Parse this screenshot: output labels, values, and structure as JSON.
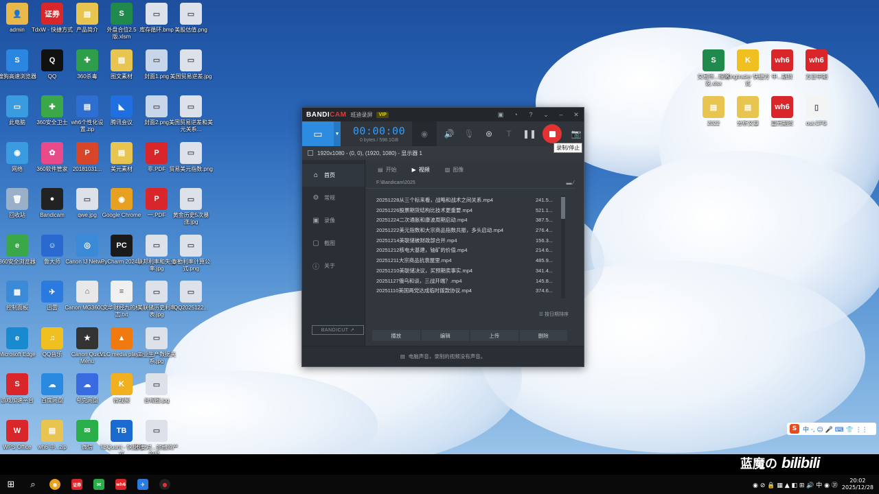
{
  "desktop_icons": [
    {
      "label": "admin",
      "color": "#e8b84a",
      "glyph": "👤"
    },
    {
      "label": "TdxW - 快捷方式",
      "color": "#d8262a",
      "glyph": "证券"
    },
    {
      "label": "产品简介",
      "color": "#e8c450",
      "glyph": "▤"
    },
    {
      "label": "外盘合位2.5版.xlsm",
      "color": "#1f8a4c",
      "glyph": "S"
    },
    {
      "label": "库存循环.bmp",
      "color": "#dde2ea",
      "glyph": "▭"
    },
    {
      "label": "美股估值.png",
      "color": "#dde2ea",
      "glyph": "▭"
    },
    {
      "label": "搜狗高速浏览器",
      "color": "#2a86e0",
      "glyph": "S"
    },
    {
      "label": "QQ",
      "color": "#111111",
      "glyph": "Q"
    },
    {
      "label": "360杀毒",
      "color": "#2e9e4a",
      "glyph": "✚"
    },
    {
      "label": "图文素材",
      "color": "#e8c450",
      "glyph": "▤"
    },
    {
      "label": "封面1.png",
      "color": "#c8d6ea",
      "glyph": "▭"
    },
    {
      "label": "美国贸易逆差.jpg",
      "color": "#dde2ea",
      "glyph": "▭"
    },
    {
      "label": "此电脑",
      "color": "#3a9be0",
      "glyph": "▭"
    },
    {
      "label": "360安全卫士",
      "color": "#3aa848",
      "glyph": "✚"
    },
    {
      "label": "wh6个性化设置.zip",
      "color": "#2e6ed0",
      "glyph": "▤"
    },
    {
      "label": "腾讯会议",
      "color": "#1f6fe0",
      "glyph": "◣"
    },
    {
      "label": "封面2.png",
      "color": "#c8d6ea",
      "glyph": "▭"
    },
    {
      "label": "美国贸易逆差和美元关系...",
      "color": "#dde2ea",
      "glyph": "▭"
    },
    {
      "label": "网络",
      "color": "#3a9be0",
      "glyph": "◉"
    },
    {
      "label": "360软件管家",
      "color": "#e84a8a",
      "glyph": "✿"
    },
    {
      "label": "20181031...",
      "color": "#d8462a",
      "glyph": "P"
    },
    {
      "label": "美元素材",
      "color": "#e8c450",
      "glyph": "▤"
    },
    {
      "label": "非.PDF",
      "color": "#d8262a",
      "glyph": "P"
    },
    {
      "label": "贸易美元指数.png",
      "color": "#dde2ea",
      "glyph": "▭"
    },
    {
      "label": "回收站",
      "color": "#9ab0c8",
      "glyph": "🗑"
    },
    {
      "label": "Bandicam",
      "color": "#222222",
      "glyph": "●"
    },
    {
      "label": "qwe.jpg",
      "color": "#dde2ea",
      "glyph": "▭"
    },
    {
      "label": "Google Chrome",
      "color": "#e8a020",
      "glyph": "◉"
    },
    {
      "label": "一.PDF",
      "color": "#d8262a",
      "glyph": "P"
    },
    {
      "label": "黄金历史5次暴涨.jpg",
      "color": "#dde2ea",
      "glyph": "▭"
    },
    {
      "label": "360安全浏览器",
      "color": "#3aa848",
      "glyph": "e"
    },
    {
      "label": "鲁大师",
      "color": "#2a6ad0",
      "glyph": "☺"
    },
    {
      "label": "Canon IJ Netwo...",
      "color": "#3a8ad8",
      "glyph": "◎"
    },
    {
      "label": "PyCharm 2024.3",
      "color": "#1a1a1a",
      "glyph": "PC"
    },
    {
      "label": "联邦利率和失业率.jpg",
      "color": "#dde2ea",
      "glyph": "▭"
    },
    {
      "label": "泰勒利率计算公式.png",
      "color": "#dde2ea",
      "glyph": "▭"
    },
    {
      "label": "控制面板",
      "color": "#3a8ad8",
      "glyph": "▦"
    },
    {
      "label": "迅雷",
      "color": "#2a7ae0",
      "glyph": "✈"
    },
    {
      "label": "Canon MG3600 ...",
      "color": "#e8e8e8",
      "glyph": "⌂"
    },
    {
      "label": "文华财经九的标志.txt",
      "color": "#f0f0f0",
      "glyph": "≡"
    },
    {
      "label": "美联储历史利率表.jpg",
      "color": "#dde2ea",
      "glyph": "▭"
    },
    {
      "label": "QQ2025122...",
      "color": "#dde2ea",
      "glyph": "▭"
    },
    {
      "label": "Microsoft Edge",
      "color": "#1a8ad0",
      "glyph": "e"
    },
    {
      "label": "QQ音乐",
      "color": "#f0c020",
      "glyph": "♫"
    },
    {
      "label": "Canon Quick Menu",
      "color": "#333333",
      "glyph": "★"
    },
    {
      "label": "VLC media player",
      "color": "#f07a10",
      "glyph": "▲"
    },
    {
      "label": "工业生产数据关系.jpg",
      "color": "#dde2ea",
      "glyph": "▭"
    },
    {
      "label": "",
      "color": "",
      "glyph": ""
    },
    {
      "label": "游戏加速平台",
      "color": "#d8262a",
      "glyph": "S"
    },
    {
      "label": "百度网盘",
      "color": "#2a8ae0",
      "glyph": "☁"
    },
    {
      "label": "夸克网盘",
      "color": "#3a6ae0",
      "glyph": "☁"
    },
    {
      "label": "微视频",
      "color": "#f0b020",
      "glyph": "K"
    },
    {
      "label": "合规图.jpg",
      "color": "#dde2ea",
      "glyph": "▭"
    },
    {
      "label": "",
      "color": "",
      "glyph": ""
    },
    {
      "label": "WPS Office",
      "color": "#d8262a",
      "glyph": "W"
    },
    {
      "label": "wh6 中...zip",
      "color": "#e8c450",
      "glyph": "▤"
    },
    {
      "label": "微信",
      "color": "#2aae4a",
      "glyph": "✉"
    },
    {
      "label": "TBQuant - 快捷方式",
      "color": "#1a6ad0",
      "glyph": "TB"
    },
    {
      "label": "不要对...金融资产的泉...",
      "color": "#dde2ea",
      "glyph": "▭"
    }
  ],
  "right_icons": [
    {
      "label": "交易所...理财说.xlsx",
      "color": "#1f8a4c",
      "glyph": "S"
    },
    {
      "label": "Kingtrader 快捷方式",
      "color": "#f0c020",
      "glyph": "K"
    },
    {
      "label": "中...期货",
      "color": "#d8262a",
      "glyph": "wh6"
    },
    {
      "label": "方正中期",
      "color": "#d8262a",
      "glyph": "wh6"
    },
    {
      "label": "2022",
      "color": "#e8c450",
      "glyph": "▤"
    },
    {
      "label": "分析文章",
      "color": "#e8c450",
      "glyph": "▤"
    },
    {
      "label": "嘉元期货",
      "color": "#d8262a",
      "glyph": "wh6"
    },
    {
      "label": "out.CFG",
      "color": "#f4f4f4",
      "glyph": "▯"
    }
  ],
  "bandicam": {
    "logo_main": "BANDI",
    "logo_cam": "CAM",
    "subtitle": "班迪录屏",
    "vip": "VIP",
    "timer": "00:00:00",
    "size": "0 bytes / 598.1GB",
    "tooltip": "录制/停止",
    "target": "1920x1080 - (0, 0), (1920, 1080) - 显示器 1",
    "sidebar": [
      {
        "label": "首页",
        "icon": "⌂"
      },
      {
        "label": "常规",
        "icon": "⚙"
      },
      {
        "label": "录像",
        "icon": "▣"
      },
      {
        "label": "截图",
        "icon": "▢"
      },
      {
        "label": "关于",
        "icon": "ⓘ"
      }
    ],
    "bandicut": "BANDICUT ↗",
    "tabs": [
      {
        "label": "开始",
        "icon": "▤"
      },
      {
        "label": "视频",
        "icon": "▶"
      },
      {
        "label": "图像",
        "icon": "▨"
      }
    ],
    "path": "F:\\Bandicam\\2025",
    "files": [
      {
        "name": "20251228从三个标来看，战略和战术之间关系.mp4",
        "size": "241.5..."
      },
      {
        "name": "20251226股票期货结构比技术更重要.mp4",
        "size": "521.1..."
      },
      {
        "name": "20251224二次通胀和康波周期启动.mp4",
        "size": "387.5..."
      },
      {
        "name": "20251222美元指数和大宗商品指数共振，多头启动.mp4",
        "size": "276.4..."
      },
      {
        "name": "20251214美联储被财政部合并.mp4",
        "size": "156.3..."
      },
      {
        "name": "20251212核电大基建，铀矿的价值.mp4",
        "size": "214.6..."
      },
      {
        "name": "20251211大宗商品抗衰屋里.mp4",
        "size": "485.9..."
      },
      {
        "name": "20251210美联储决议，买预期卖事实.mp4",
        "size": "341.4..."
      },
      {
        "name": "20251127俄乌和谈，三战开端？.mp4",
        "size": "145.8..."
      },
      {
        "name": "20251110美国两党达成临时拨款协议.mp4",
        "size": "374.6..."
      }
    ],
    "sort": "☰ 按日期排序",
    "actions": [
      "播放",
      "编辑",
      "上传",
      "删除"
    ],
    "status": "电脑声音，录制的视频没有声音。"
  },
  "watermark": {
    "text": "蓝魔の",
    "brand": "bilibili"
  },
  "ime": {
    "logo": "S",
    "items": "中 ·, ☺ 🎤 ⌨ 👕 ⋮⋮"
  },
  "taskbar": {
    "time": "20:02",
    "date": "2025/12/28",
    "tray": "◉ ⊘ 🔒 ▦ ▲ ◧ ⊞ 🔊 中 ◉ ㉛"
  }
}
